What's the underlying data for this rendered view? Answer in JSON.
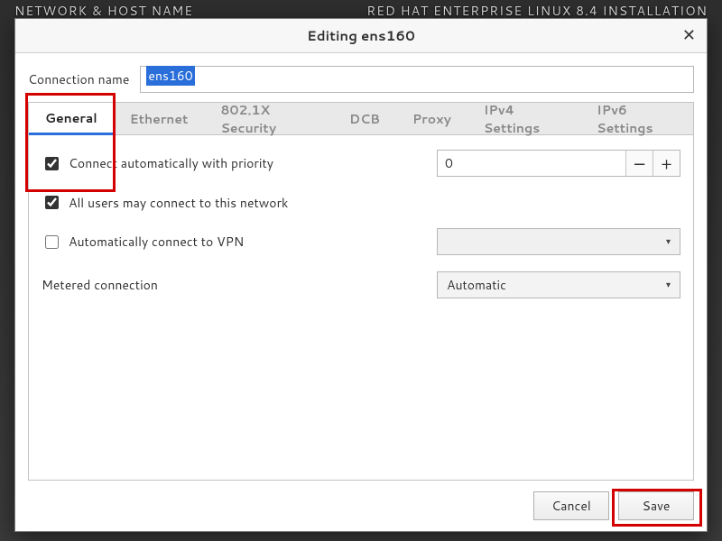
{
  "background": {
    "leftTitle": "NETWORK & HOST NAME",
    "rightTitle": "RED HAT ENTERPRISE LINUX 8.4 INSTALLATION"
  },
  "dialog": {
    "title": "Editing ens160",
    "connectionNameLabel": "Connection name",
    "connectionNameValue": "ens160",
    "tabs": {
      "general": "General",
      "ethernet": "Ethernet",
      "security": "802.1X Security",
      "dcb": "DCB",
      "proxy": "Proxy",
      "ipv4": "IPv4 Settings",
      "ipv6": "IPv6 Settings"
    },
    "general": {
      "connectAutoLabel": "Connect automatically with priority",
      "priorityValue": "0",
      "allUsersLabel": "All users may connect to this network",
      "autoVpnLabel": "Automatically connect to VPN",
      "meteredLabel": "Metered connection",
      "meteredValue": "Automatic"
    },
    "buttons": {
      "cancel": "Cancel",
      "save": "Save"
    }
  }
}
